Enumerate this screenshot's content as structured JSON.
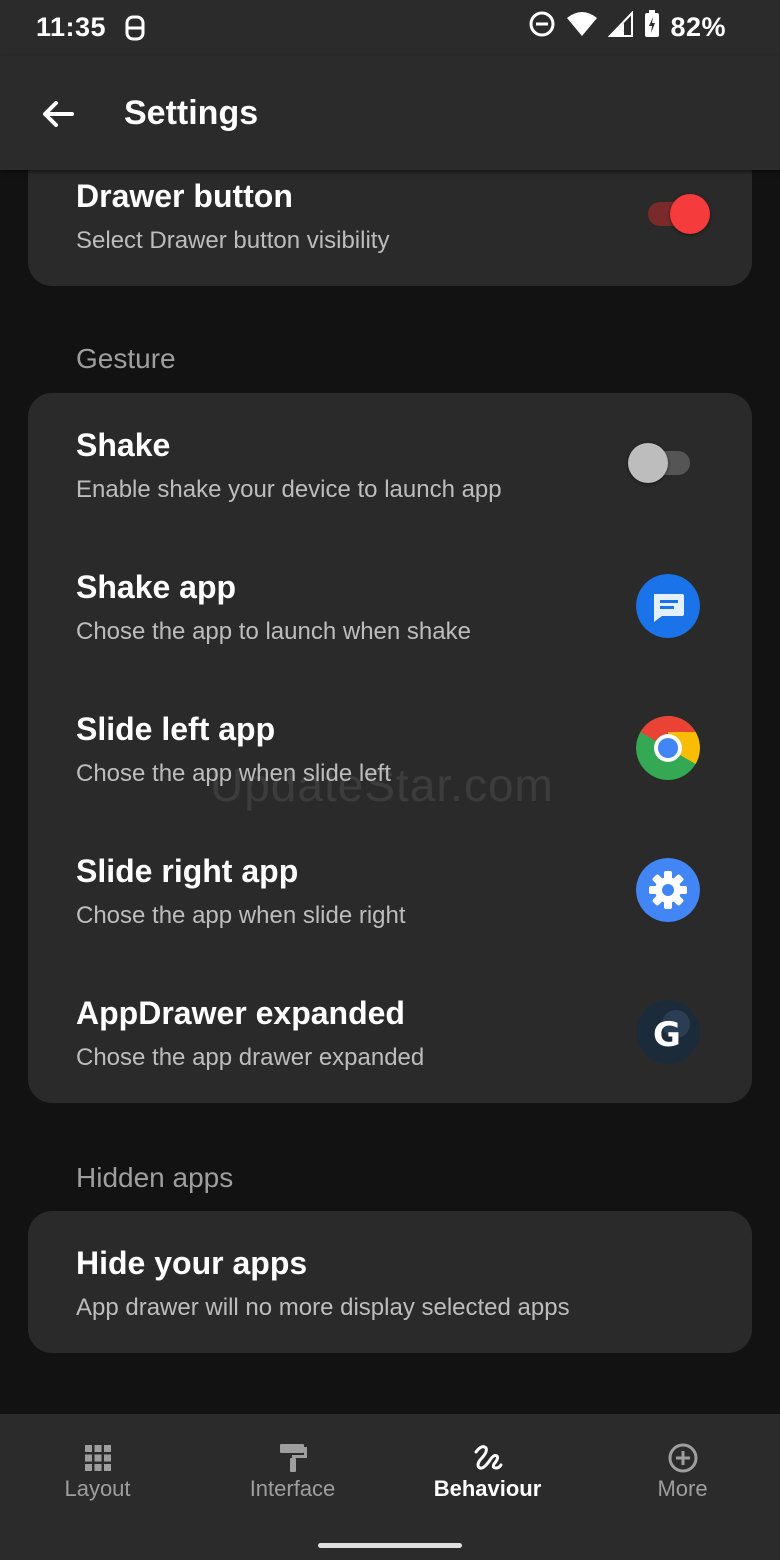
{
  "status_bar": {
    "time": "11:35",
    "battery": "82%"
  },
  "app_bar": {
    "title": "Settings",
    "back_icon": "arrow-back-icon"
  },
  "drawer_card": {
    "title": "Drawer button",
    "subtitle": "Select Drawer button visibility",
    "toggle_on": true,
    "accent_color": "#f53b3b"
  },
  "gesture": {
    "header": "Gesture",
    "items": [
      {
        "title": "Shake",
        "subtitle": "Enable shake your device to launch app",
        "control": "toggle-off"
      },
      {
        "title": "Shake app",
        "subtitle": "Chose the app to launch when shake",
        "control": "messages-app-icon"
      },
      {
        "title": "Slide left app",
        "subtitle": "Chose the app when slide left",
        "control": "chrome-app-icon"
      },
      {
        "title": "Slide right app",
        "subtitle": "Chose the app when slide right",
        "control": "settings-app-icon"
      },
      {
        "title": "AppDrawer expanded",
        "subtitle": "Chose the app drawer expanded",
        "control": "google-app-icon"
      }
    ]
  },
  "hidden_apps": {
    "header": "Hidden apps",
    "title": "Hide your apps",
    "subtitle": "App drawer will no more display selected apps"
  },
  "bottom_nav": [
    {
      "label": "Layout",
      "icon": "grid-icon",
      "active": false
    },
    {
      "label": "Interface",
      "icon": "paint-roller-icon",
      "active": false
    },
    {
      "label": "Behaviour",
      "icon": "gesture-icon",
      "active": true
    },
    {
      "label": "More",
      "icon": "add-circle-icon",
      "active": false
    }
  ],
  "watermark": "UpdateStar.com"
}
